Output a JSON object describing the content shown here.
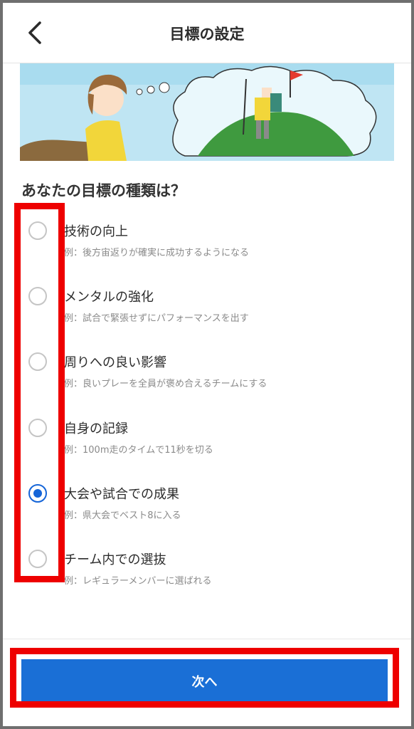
{
  "header": {
    "title": "目標の設定",
    "back_icon": "chevron-left-icon"
  },
  "question": "あなたの目標の種類は？",
  "options": [
    {
      "label": "技術の向上",
      "example": "例：後方宙返りが確実に成功するようになる",
      "checked": false
    },
    {
      "label": "メンタルの強化",
      "example": "例：試合で緊張せずにパフォーマンスを出す",
      "checked": false
    },
    {
      "label": "周りへの良い影響",
      "example": "例：良いプレーを全員が褒め合えるチームにする",
      "checked": false
    },
    {
      "label": "自身の記録",
      "example": "例：100m走のタイムで11秒を切る",
      "checked": false
    },
    {
      "label": "大会や試合での成果",
      "example": "例：県大会でベスト8に入る",
      "checked": true
    },
    {
      "label": "チーム内での選抜",
      "example": "例：レギュラーメンバーに選ばれる",
      "checked": false
    }
  ],
  "next_button": {
    "label": "次へ"
  },
  "colors": {
    "accent": "#1a6fd6",
    "highlight": "#ee0000"
  }
}
